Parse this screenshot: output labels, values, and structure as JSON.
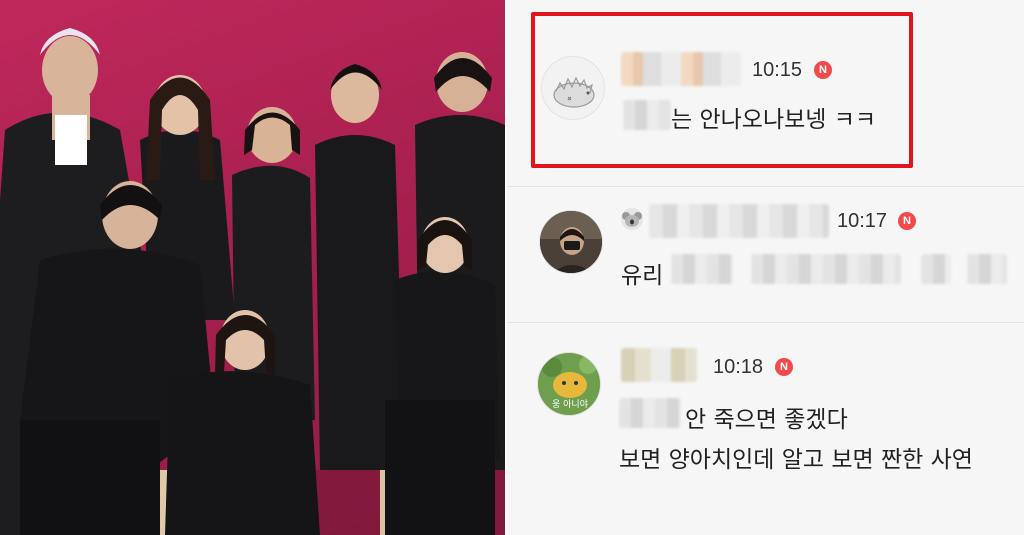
{
  "comments": [
    {
      "time": "10:15",
      "badge": "N",
      "text": "는 안나오나보넹 ㅋㅋ",
      "highlighted": true
    },
    {
      "time": "10:17",
      "badge": "N",
      "text": "유리"
    },
    {
      "time": "10:18",
      "badge": "N",
      "avatar_caption": "웅 아니야",
      "text_line_1": "안 죽으면 좋겠다",
      "text_line_2": "보면 양아치인데 알고 보면 짠한 사연"
    }
  ],
  "colors": {
    "highlight_border": "#e0161c",
    "badge": "#f04a4a",
    "photo_background": "#b0234f"
  },
  "icons": {
    "n_badge": "new-badge-icon",
    "koala": "koala-icon"
  }
}
